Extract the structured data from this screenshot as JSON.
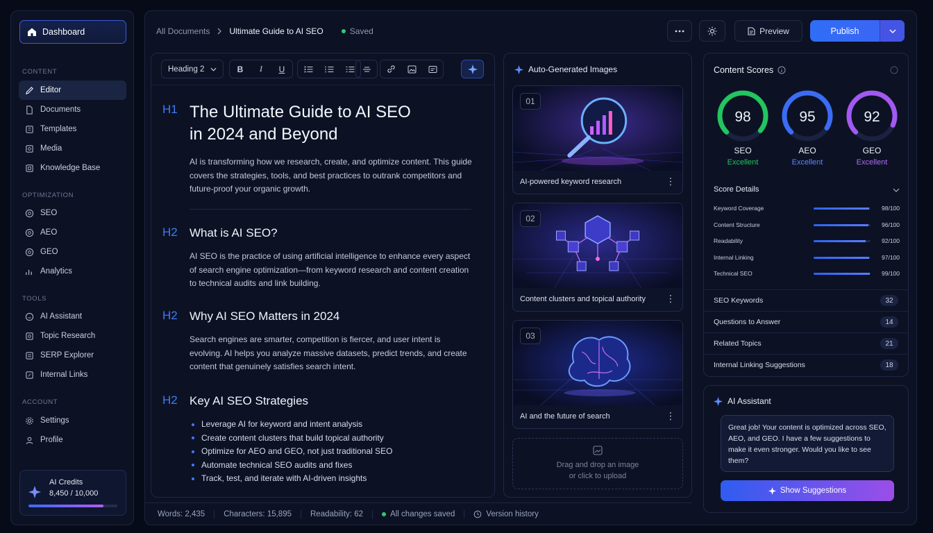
{
  "sidebar": {
    "dashboard": "Dashboard",
    "sections": [
      {
        "title": "CONTENT",
        "items": [
          "Editor",
          "Documents",
          "Templates",
          "Media",
          "Knowledge Base"
        ]
      },
      {
        "title": "OPTIMIZATION",
        "items": [
          "SEO",
          "AEO",
          "GEO",
          "Analytics"
        ]
      },
      {
        "title": "TOOLS",
        "items": [
          "AI Assistant",
          "Topic Research",
          "SERP Explorer",
          "Internal Links"
        ]
      },
      {
        "title": "ACCOUNT",
        "items": [
          "Settings",
          "Profile"
        ]
      }
    ],
    "credits": {
      "title": "AI Credits",
      "value": "8,450 / 10,000",
      "fraction": 0.845
    }
  },
  "header": {
    "breadcrumb_root": "All Documents",
    "breadcrumb_current": "Ultimate Guide to AI SEO",
    "saved": "Saved",
    "preview": "Preview",
    "publish": "Publish"
  },
  "editor": {
    "heading_select": "Heading 2",
    "h1_mark": "H1",
    "h2_mark": "H2",
    "title_line1": "The Ultimate Guide to AI SEO",
    "title_line2": "in 2024 and Beyond",
    "intro": "AI is transforming how we research, create, and optimize content. This guide covers the strategies, tools, and best practices to outrank competitors and future-proof your organic growth.",
    "sections": [
      {
        "heading": "What is AI SEO?",
        "body": "AI SEO is the practice of using artificial intelligence to enhance every aspect of search engine optimization—from keyword research and content creation to technical audits and link building."
      },
      {
        "heading": "Why AI SEO Matters in 2024",
        "body": "Search engines are smarter, competition is fiercer, and user intent is evolving. AI helps you analyze massive datasets, predict trends, and create content that genuinely satisfies search intent."
      },
      {
        "heading": "Key AI SEO Strategies",
        "body": ""
      }
    ],
    "bullets": [
      "Leverage AI for keyword and intent analysis",
      "Create content clusters that build topical authority",
      "Optimize for AEO and GEO, not just traditional SEO",
      "Automate technical SEO audits and fixes",
      "Track, test, and iterate with AI-driven insights"
    ]
  },
  "images": {
    "title": "Auto-Generated Images",
    "cards": [
      {
        "num": "01",
        "caption": "AI-powered keyword research"
      },
      {
        "num": "02",
        "caption": "Content clusters and topical authority"
      },
      {
        "num": "03",
        "caption": "AI and the future of search"
      }
    ],
    "drop_line1": "Drag and drop an image",
    "drop_line2": "or click to upload"
  },
  "scores": {
    "title": "Content Scores",
    "rings": [
      {
        "label": "SEO",
        "value": "98",
        "status": "Excellent",
        "color": "#22c55e",
        "fraction": 0.98
      },
      {
        "label": "AEO",
        "value": "95",
        "status": "Excellent",
        "color": "#3b6cf6",
        "fraction": 0.95
      },
      {
        "label": "GEO",
        "value": "92",
        "status": "Excellent",
        "color": "#a259f2",
        "fraction": 0.92
      }
    ],
    "details_title": "Score Details",
    "details": [
      {
        "name": "Keyword Coverage",
        "value": "98/100",
        "fraction": 0.98
      },
      {
        "name": "Content Structure",
        "value": "96/100",
        "fraction": 0.96
      },
      {
        "name": "Readability",
        "value": "92/100",
        "fraction": 0.92
      },
      {
        "name": "Internal Linking",
        "value": "97/100",
        "fraction": 0.97
      },
      {
        "name": "Technical SEO",
        "value": "99/100",
        "fraction": 0.99
      }
    ],
    "lists": [
      {
        "name": "SEO Keywords",
        "count": "32"
      },
      {
        "name": "Questions to Answer",
        "count": "14"
      },
      {
        "name": "Related Topics",
        "count": "21"
      },
      {
        "name": "Internal Linking Suggestions",
        "count": "18"
      }
    ]
  },
  "assistant": {
    "title": "AI Assistant",
    "message": "Great job! Your content is optimized across SEO, AEO, and GEO. I have a few suggestions to make it even stronger. Would you like to see them?",
    "button": "Show Suggestions"
  },
  "footer": {
    "words": "Words: 2,435",
    "characters": "Characters: 15,895",
    "readability": "Readability: 62",
    "status": "All changes saved",
    "history": "Version history"
  }
}
